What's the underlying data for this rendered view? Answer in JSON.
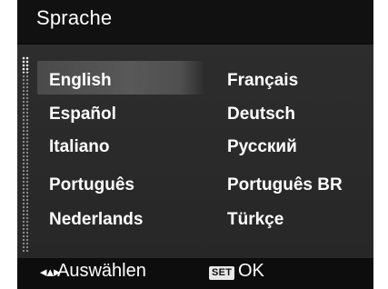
{
  "header": {
    "title": "Sprache"
  },
  "menu": {
    "selected": "English",
    "left_column": [
      "English",
      "Español",
      "Italiano",
      "Português",
      "Nederlands"
    ],
    "right_column": [
      "Français",
      "Deutsch",
      "Русский",
      "Português BR",
      "Türkçe"
    ]
  },
  "footer": {
    "nav_icon": "left-right-arrows-icon",
    "nav_label": "Auswählen",
    "set_badge": "SET",
    "ok_label": "OK"
  },
  "colors": {
    "background": "#2a2a2a",
    "header": "#111111",
    "footer": "#0d0d0d",
    "highlight": "#585858",
    "text": "#ffffff"
  }
}
